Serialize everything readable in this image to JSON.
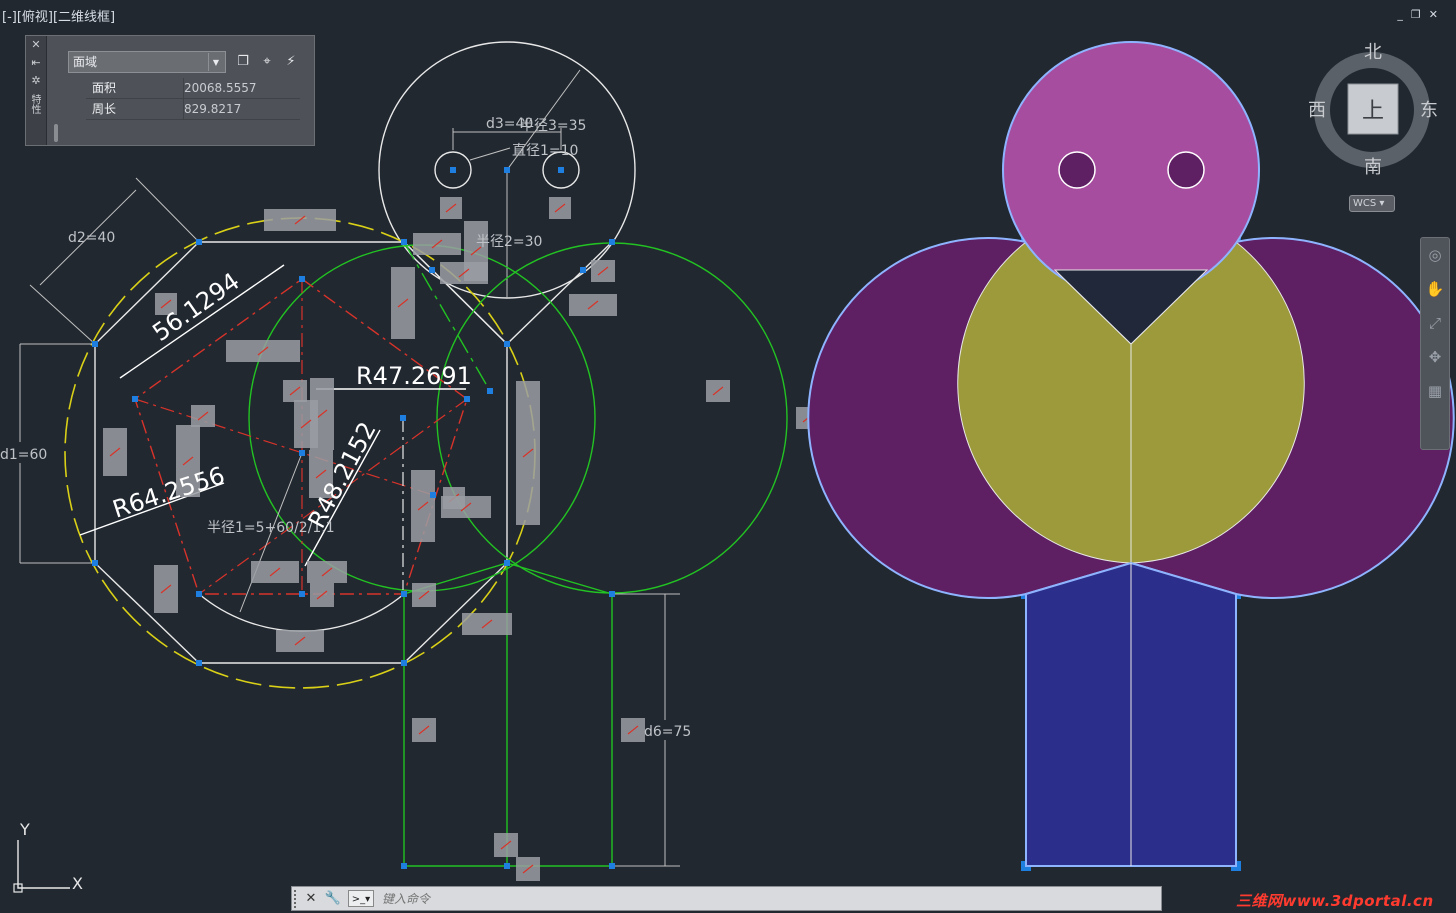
{
  "viewport": {
    "label": "[-][俯视][二维线框]",
    "buttons": [
      "_",
      "❐",
      "✕"
    ]
  },
  "palette": {
    "strip_icons": [
      "close-icon",
      "autohide-icon",
      "settings-icon"
    ],
    "title": "特性",
    "selected_type": "面域",
    "rows": [
      {
        "label": "面积",
        "value": "20068.5557"
      },
      {
        "label": "周长",
        "value": "829.8217"
      }
    ]
  },
  "dimensions": {
    "d3": "d3=40",
    "d_overlap": "半径3=35",
    "diameter1": "直径1=10",
    "radius2": "半径2=30",
    "d2": "d2=40",
    "d1": "d1=60",
    "radius1": "半径1=5+60/2/1.1",
    "d6": "d6=75",
    "r1": "56.1294",
    "r2": "R47.2691",
    "r3": "R64.2556",
    "r4": "R48.2152"
  },
  "viewcube": {
    "north": "北",
    "south": "南",
    "east": "东",
    "west": "西",
    "top": "上",
    "wcs": "WCS"
  },
  "ucs": {
    "x": "X",
    "y": "Y"
  },
  "command": {
    "placeholder": "键入命令"
  },
  "watermark": "三维网www.3dportal.cn",
  "colors": {
    "background": "#212830",
    "head_fill": "#a64d9f",
    "body_outer_fill": "#5e1f63",
    "body_inner_fill": "#9c9a3a",
    "legs_fill": "#2b2e8a",
    "constraint_green": "#22c322",
    "constraint_yellow": "#d9d017",
    "constraint_red": "#d8332a",
    "grip_blue": "#1e7fe0"
  }
}
